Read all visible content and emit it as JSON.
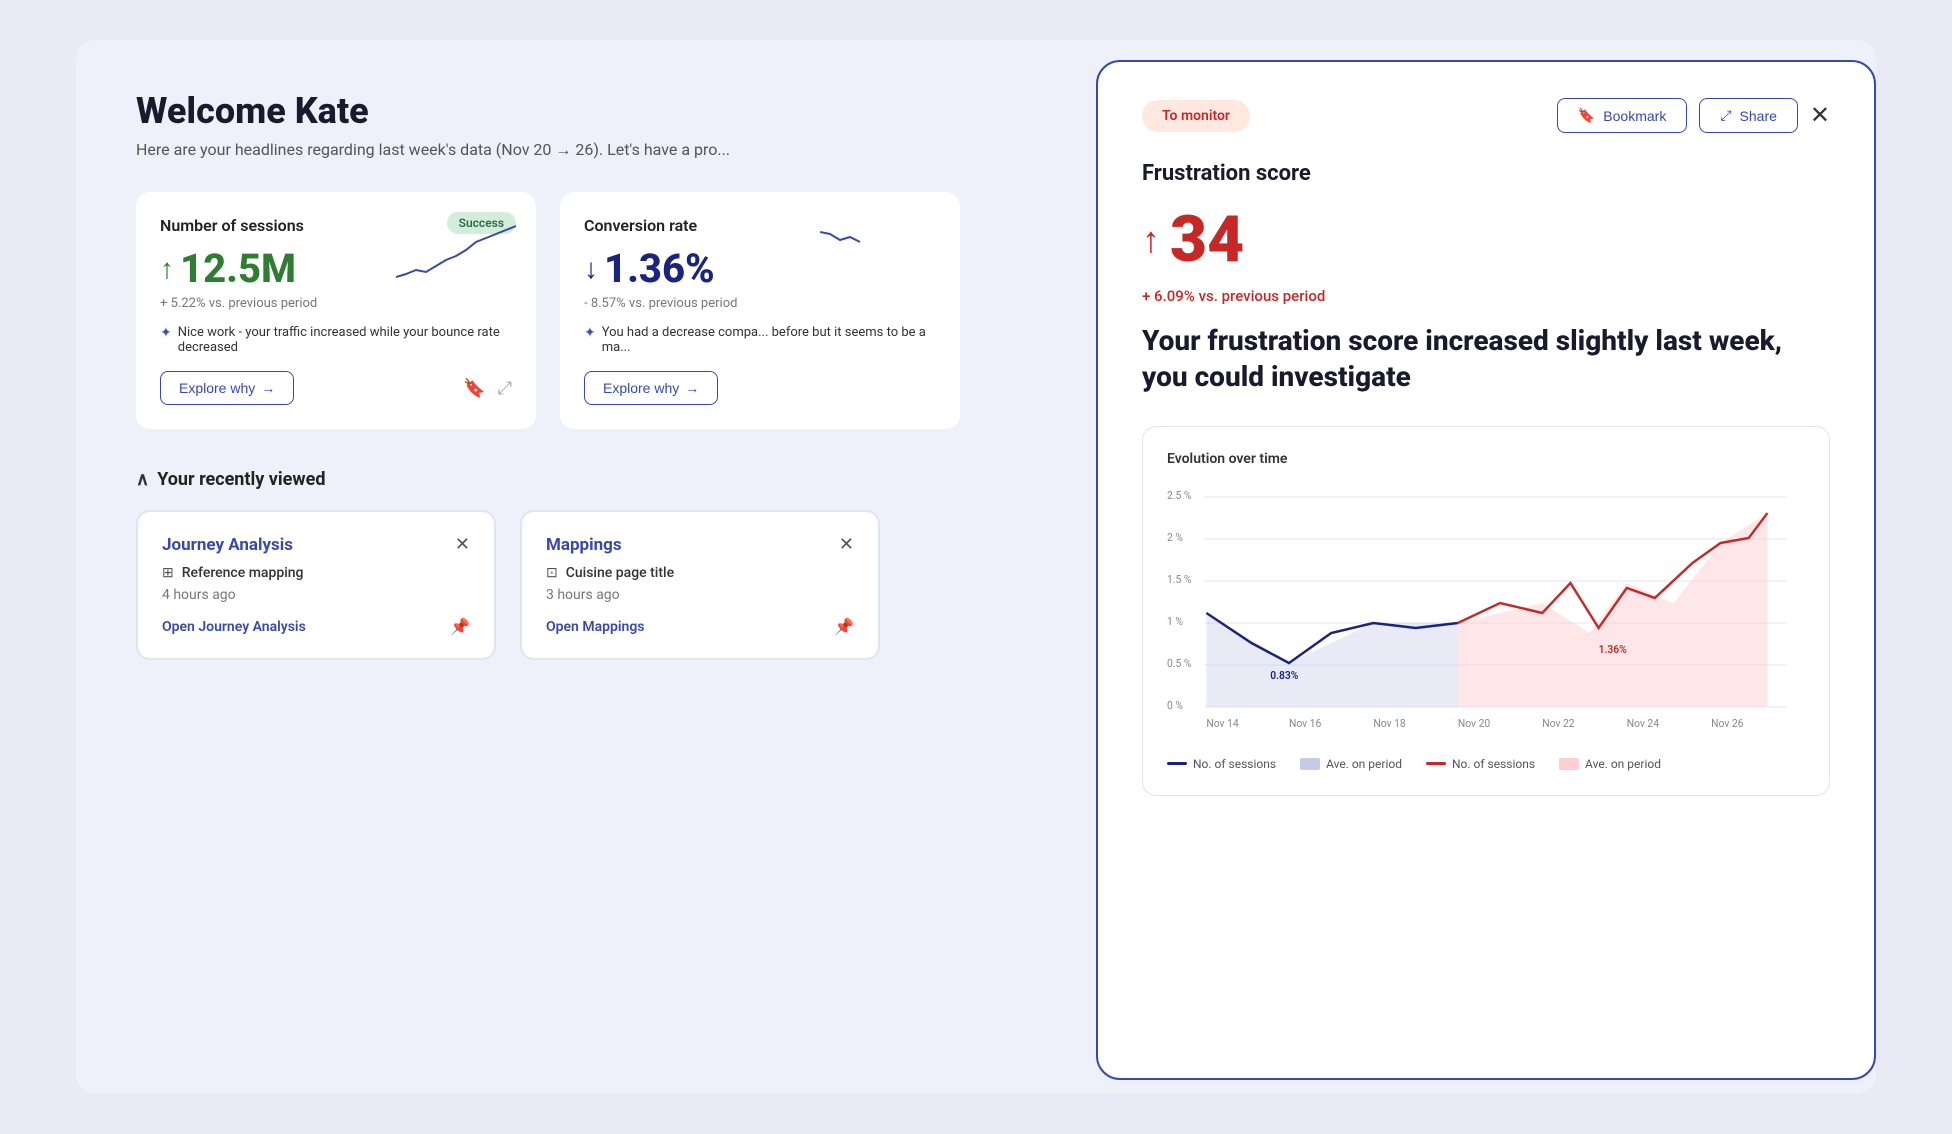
{
  "dashboard": {
    "welcome_title": "Welcome Kate",
    "welcome_subtitle": "Here are your headlines regarding last week's data (Nov 20 → 26). Let's have a pro...",
    "cards": [
      {
        "title": "Number of sessions",
        "badge": "Success",
        "value": "12.5M",
        "direction": "up",
        "change": "+ 5.22% vs. previous period",
        "note": "Nice work - your traffic increased while your bounce rate decreased",
        "explore_label": "Explore why"
      },
      {
        "title": "Conversion rate",
        "value": "1.36%",
        "direction": "down",
        "change": "- 8.57% vs. previous period",
        "note": "You had a decrease compa... before but it seems to be a ma...",
        "explore_label": "Explore why"
      }
    ],
    "recently_viewed": {
      "title": "Your recently viewed",
      "items": [
        {
          "type": "Journey Analysis",
          "item_icon": "grid",
          "item_name": "Reference mapping",
          "time_ago": "4 hours ago",
          "open_label": "Open Journey Analysis",
          "pinned": true
        },
        {
          "type": "Mappings",
          "item_icon": "grid",
          "item_name": "Cuisine page title",
          "time_ago": "3 hours ago",
          "open_label": "Open Mappings",
          "pinned": true
        }
      ]
    }
  },
  "frustration_panel": {
    "monitor_badge": "To monitor",
    "bookmark_label": "Bookmark",
    "share_label": "Share",
    "section_label": "Frustration score",
    "score": "34",
    "score_change": "+ 6.09% vs. previous period",
    "description": "Your frustration score increased slightly last week, you could investigate",
    "chart": {
      "title": "Evolution over time",
      "y_labels": [
        "2.5 %",
        "2 %",
        "1.5 %",
        "1 %",
        "0.5 %",
        "0 %"
      ],
      "x_labels": [
        "Nov 14",
        "Nov 16",
        "Nov 18",
        "Nov 20",
        "Nov 22",
        "Nov 24",
        "Nov 26"
      ],
      "annotation_left": "0.83%",
      "annotation_right": "1.36%",
      "legend": [
        {
          "label": "No. of sessions",
          "style": "navy-line"
        },
        {
          "label": "Ave. on period",
          "style": "navy-area"
        },
        {
          "label": "No. of sessions",
          "style": "red-line"
        },
        {
          "label": "Ave. on period",
          "style": "red-area"
        }
      ]
    }
  }
}
